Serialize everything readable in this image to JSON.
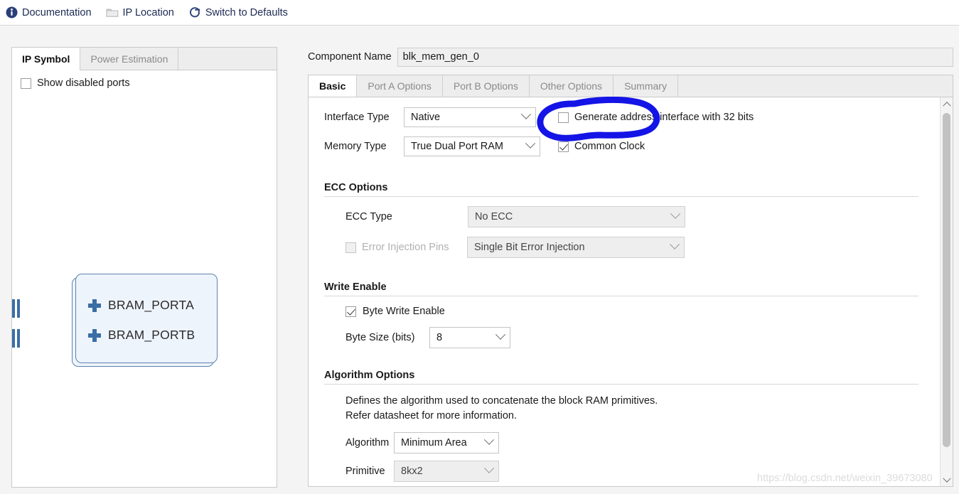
{
  "toolbar": {
    "items": [
      {
        "label": "Documentation",
        "icon": "info-icon",
        "dim": false
      },
      {
        "label": "IP Location",
        "icon": "folder-icon",
        "dim": false
      },
      {
        "label": "Switch to Defaults",
        "icon": "refresh-icon",
        "dim": false
      }
    ]
  },
  "left_panel": {
    "tabs": [
      {
        "label": "IP Symbol",
        "active": true
      },
      {
        "label": "Power Estimation",
        "active": false
      }
    ],
    "show_disabled_ports": {
      "label": "Show disabled ports",
      "checked": false
    },
    "symbol": {
      "ports": [
        {
          "label": "BRAM_PORTA"
        },
        {
          "label": "BRAM_PORTB"
        }
      ]
    }
  },
  "right_panel": {
    "component_name": {
      "label": "Component Name",
      "value": "blk_mem_gen_0"
    },
    "tabs": [
      {
        "label": "Basic",
        "active": true
      },
      {
        "label": "Port A Options",
        "active": false
      },
      {
        "label": "Port B Options",
        "active": false
      },
      {
        "label": "Other Options",
        "active": false
      },
      {
        "label": "Summary",
        "active": false
      }
    ],
    "basic": {
      "interface_type": {
        "label": "Interface Type",
        "value": "Native"
      },
      "memory_type": {
        "label": "Memory Type",
        "value": "True Dual Port RAM"
      },
      "generate_address_interface": {
        "label": "Generate address interface with 32 bits",
        "checked": false
      },
      "common_clock": {
        "label": "Common Clock",
        "checked": true
      },
      "ecc_options": {
        "title": "ECC Options",
        "ecc_type": {
          "label": "ECC Type",
          "value": "No ECC",
          "disabled": true
        },
        "error_injection_pins": {
          "label": "Error Injection Pins",
          "checked": false,
          "disabled": true,
          "value": "Single Bit Error Injection"
        }
      },
      "write_enable": {
        "title": "Write Enable",
        "byte_write_enable": {
          "label": "Byte Write Enable",
          "checked": true
        },
        "byte_size": {
          "label": "Byte Size (bits)",
          "value": "8"
        }
      },
      "algorithm_options": {
        "title": "Algorithm Options",
        "description_line1": "Defines the algorithm used to concatenate the block RAM primitives.",
        "description_line2": "Refer datasheet for more information.",
        "algorithm": {
          "label": "Algorithm",
          "value": "Minimum Area"
        },
        "primitive": {
          "label": "Primitive",
          "value": "8kx2"
        }
      }
    }
  },
  "annotation": {
    "shape": "hand-drawn-oval",
    "color": "#1414e6"
  },
  "watermark": {
    "text": "https://blog.csdn.net/weixin_39673080"
  },
  "colors": {
    "accent_blue": "#1b2a52",
    "symbol_fill": "#eef4fc",
    "symbol_border": "#5d82ad",
    "annotation": "#1414e6"
  }
}
